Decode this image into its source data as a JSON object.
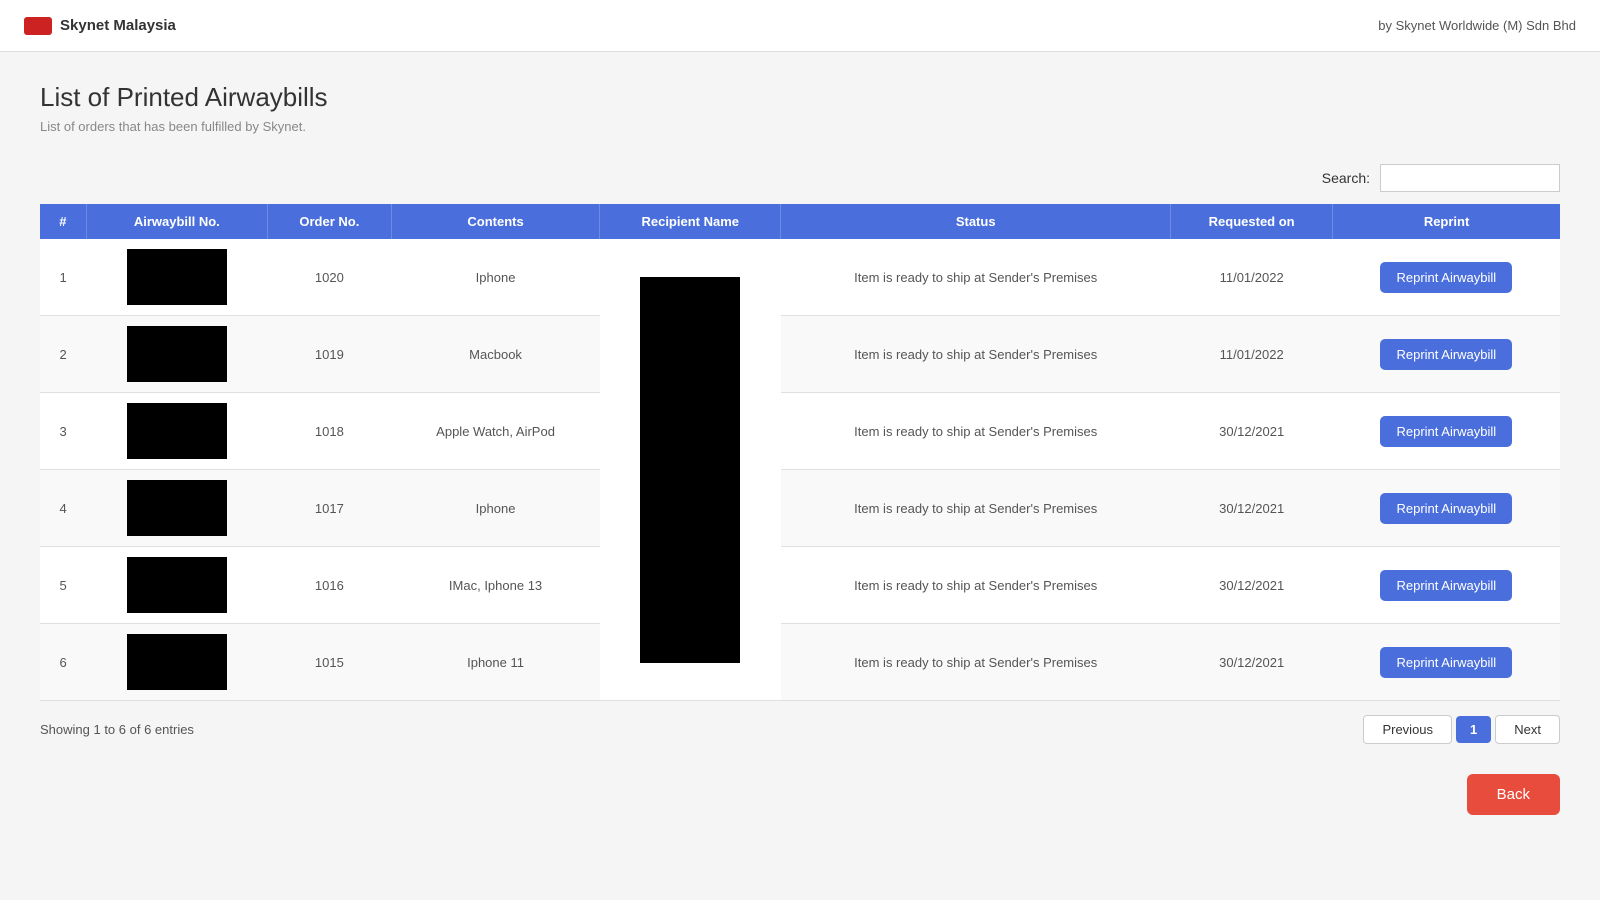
{
  "navbar": {
    "brand": "Skynet Malaysia",
    "tagline": "by Skynet Worldwide (M) Sdn Bhd"
  },
  "page": {
    "title": "List of Printed Airwaybills",
    "subtitle": "List of orders that has been fulfilled by Skynet."
  },
  "search": {
    "label": "Search:",
    "placeholder": ""
  },
  "table": {
    "headers": [
      "#",
      "Airwaybill No.",
      "Order No.",
      "Contents",
      "Recipient Name",
      "Status",
      "Requested on",
      "Reprint"
    ],
    "rows": [
      {
        "index": 1,
        "order_no": "1020",
        "contents": "Iphone",
        "status": "Item is ready to ship at Sender's Premises",
        "requested_on": "11/01/2022",
        "reprint_label": "Reprint Airwaybill"
      },
      {
        "index": 2,
        "order_no": "1019",
        "contents": "Macbook",
        "status": "Item is ready to ship at Sender's Premises",
        "requested_on": "11/01/2022",
        "reprint_label": "Reprint Airwaybill"
      },
      {
        "index": 3,
        "order_no": "1018",
        "contents": "Apple Watch, AirPod",
        "status": "Item is ready to ship at Sender's Premises",
        "requested_on": "30/12/2021",
        "reprint_label": "Reprint Airwaybill"
      },
      {
        "index": 4,
        "order_no": "1017",
        "contents": "Iphone",
        "status": "Item is ready to ship at Sender's Premises",
        "requested_on": "30/12/2021",
        "reprint_label": "Reprint Airwaybill"
      },
      {
        "index": 5,
        "order_no": "1016",
        "contents": "IMac, Iphone 13",
        "status": "Item is ready to ship at Sender's Premises",
        "requested_on": "30/12/2021",
        "reprint_label": "Reprint Airwaybill"
      },
      {
        "index": 6,
        "order_no": "1015",
        "contents": "Iphone 11",
        "status": "Item is ready to ship at Sender's Premises",
        "requested_on": "30/12/2021",
        "reprint_label": "Reprint Airwaybill"
      }
    ]
  },
  "pagination": {
    "entries_info": "Showing 1 to 6 of 6 entries",
    "previous_label": "Previous",
    "next_label": "Next",
    "current_page": "1"
  },
  "back_button": {
    "label": "Back"
  }
}
